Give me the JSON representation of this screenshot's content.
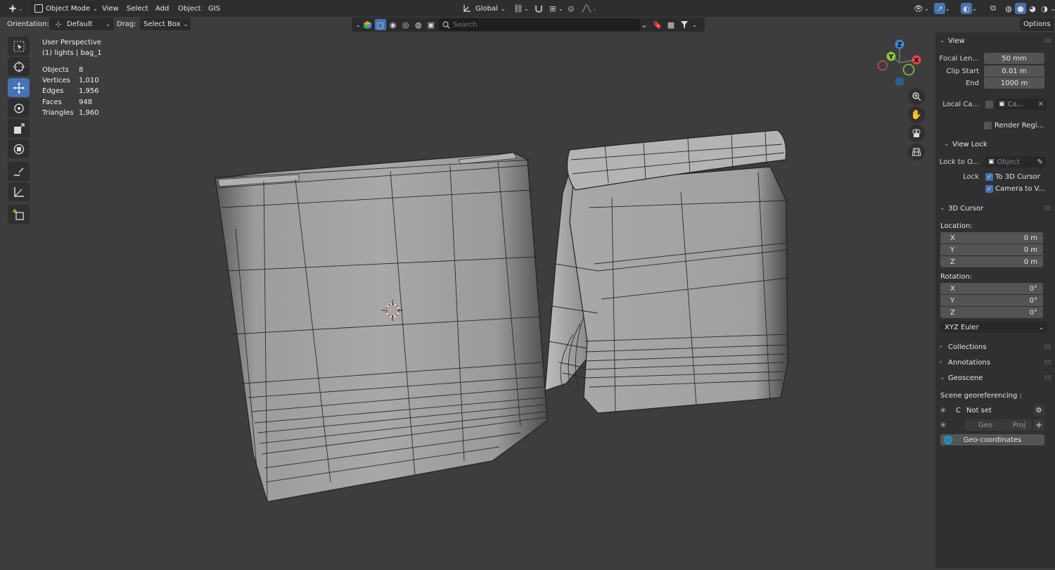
{
  "header": {
    "mode_label": "Object Mode",
    "menu": [
      "View",
      "Select",
      "Add",
      "Object",
      "GIS"
    ],
    "transform_orientation": "Global"
  },
  "tool_settings": {
    "orientation_label": "Orientation:",
    "orientation_value": "Default",
    "drag_label": "Drag:",
    "drag_value": "Select Box",
    "search_placeholder": "Search",
    "options_label": "Options"
  },
  "viewport": {
    "view_name": "User Perspective",
    "collection_line": "(1) lights | bag_1",
    "stats": [
      {
        "label": "Objects",
        "value": "8"
      },
      {
        "label": "Vertices",
        "value": "1,010"
      },
      {
        "label": "Edges",
        "value": "1,956"
      },
      {
        "label": "Faces",
        "value": "948"
      },
      {
        "label": "Triangles",
        "value": "1,960"
      }
    ],
    "gizmo_axes": {
      "x": "X",
      "y": "Y",
      "z": "Z"
    }
  },
  "sidebar": {
    "view": {
      "title": "View",
      "focal_label": "Focal Len...",
      "focal_value": "50 mm",
      "clip_start_label": "Clip Start",
      "clip_start_value": "0.01 m",
      "end_label": "End",
      "end_value": "1000 m",
      "local_camera_label": "Local Ca...",
      "local_camera_value": "Ca...",
      "render_region_label": "Render Regi..."
    },
    "view_lock": {
      "title": "View Lock",
      "lock_to_object_label": "Lock to O...",
      "lock_to_object_placeholder": "Object",
      "lock_label": "Lock",
      "to_3d_cursor_label": "To 3D Cursor",
      "camera_to_view_label": "Camera to V..."
    },
    "cursor": {
      "title": "3D Cursor",
      "location_label": "Location:",
      "location": [
        {
          "axis": "X",
          "value": "0 m"
        },
        {
          "axis": "Y",
          "value": "0 m"
        },
        {
          "axis": "Z",
          "value": "0 m"
        }
      ],
      "rotation_label": "Rotation:",
      "rotation": [
        {
          "axis": "X",
          "value": "0°"
        },
        {
          "axis": "Y",
          "value": "0°"
        },
        {
          "axis": "Z",
          "value": "0°"
        }
      ],
      "rotation_mode": "XYZ Euler"
    },
    "collections_title": "Collections",
    "annotations_title": "Annotations",
    "geoscene": {
      "title": "Geoscene",
      "georef_label": "Scene georeferencing :",
      "crs_letter": "C",
      "status": "Not set",
      "geo_label": "Geo",
      "proj_label": "Proj",
      "geo_coords_label": "Geo-coordinates"
    }
  },
  "colors": {
    "accent": "#4772b3",
    "x_axis": "#e2474f",
    "y_axis": "#8bc53f",
    "z_axis": "#3c89d8",
    "viewport_bg": "#3d3d3d"
  }
}
